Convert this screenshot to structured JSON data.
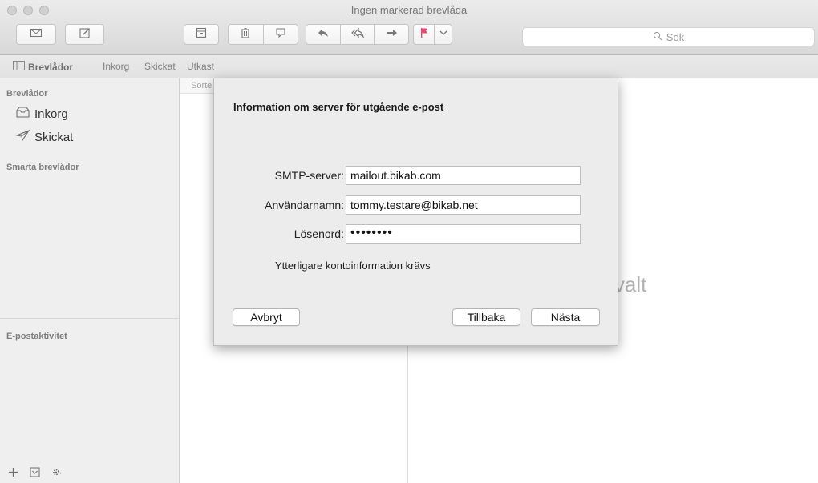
{
  "window": {
    "title": "Ingen markerad brevlåda"
  },
  "toolbar": {
    "buttons": [
      {
        "name": "get-mail",
        "icon": "envelope-icon"
      },
      {
        "name": "compose",
        "icon": "compose-icon"
      },
      {
        "name": "archive",
        "icon": "archive-icon"
      },
      {
        "name": "trash",
        "icon": "trash-icon"
      },
      {
        "name": "junk",
        "icon": "junk-icon"
      },
      {
        "name": "reply",
        "icon": "reply-icon"
      },
      {
        "name": "reply-all",
        "icon": "reply-all-icon"
      },
      {
        "name": "forward",
        "icon": "forward-icon"
      },
      {
        "name": "flag",
        "icon": "flag-icon"
      },
      {
        "name": "flag-menu",
        "icon": "chevron-down-icon"
      }
    ],
    "search_placeholder": "Sök",
    "flag_color": "#f2436c"
  },
  "favorites": {
    "mailboxes_label": "Brevlådor",
    "inbox_label": "Inkorg",
    "sent_label": "Skickat",
    "drafts_label": "Utkast"
  },
  "sidebar": {
    "header_mailboxes": "Brevlådor",
    "items": [
      {
        "label": "Inkorg",
        "icon": "inbox-tray-icon"
      },
      {
        "label": "Skickat",
        "icon": "paper-plane-icon"
      }
    ],
    "header_smart": "Smarta brevlådor",
    "header_activity": "E-postaktivitet"
  },
  "message_list": {
    "sort_label": "Sorte"
  },
  "preview": {
    "no_selection": "rev valt"
  },
  "dialog": {
    "title": "Information om server för utgående e-post",
    "fields": [
      {
        "label": "SMTP-server:",
        "value": "mailout.bikab.com"
      },
      {
        "label": "Användarnamn:",
        "value": "tommy.testare@bikab.net"
      },
      {
        "label": "Lösenord:",
        "value": "••••••••"
      }
    ],
    "note": "Ytterligare kontoinformation krävs",
    "buttons": {
      "cancel": "Avbryt",
      "back": "Tillbaka",
      "next": "Nästa"
    }
  }
}
